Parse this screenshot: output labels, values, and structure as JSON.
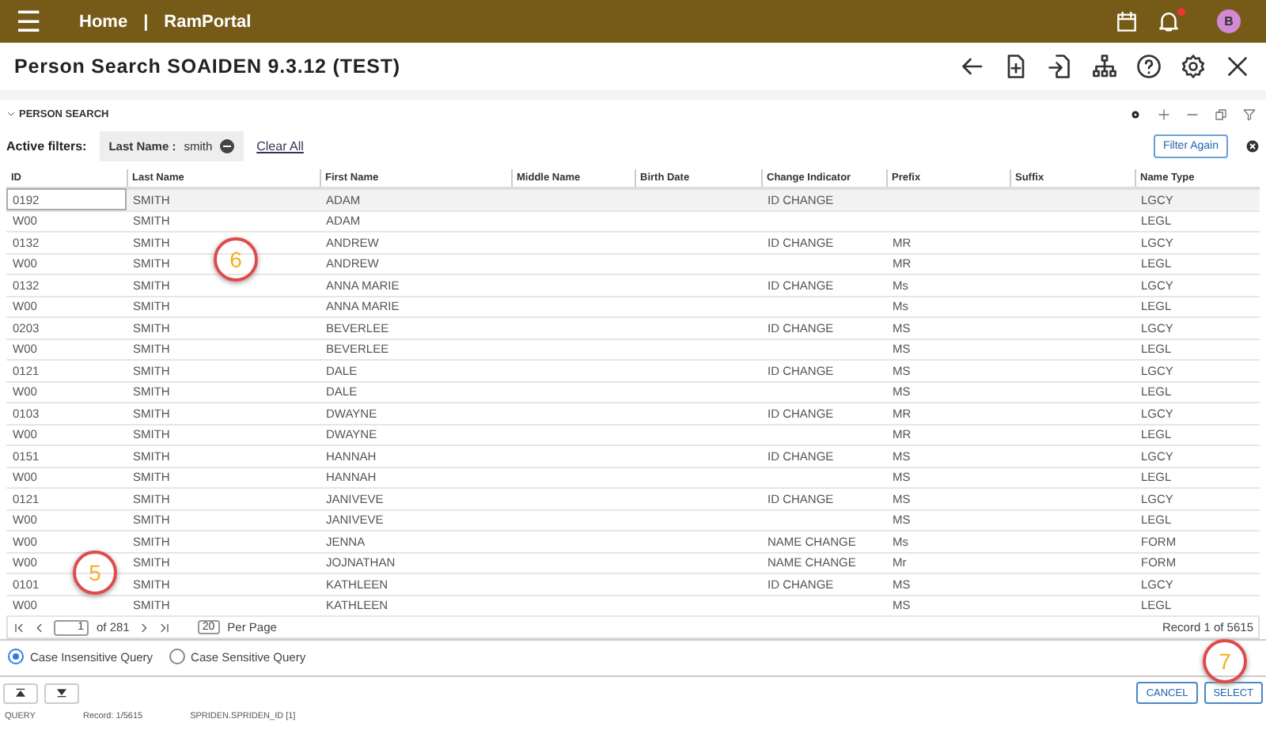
{
  "topbar": {
    "menu_icon": "☰",
    "home": "Home",
    "separator": "|",
    "portal": "RamPortal",
    "avatar": "B",
    "notification": true
  },
  "window": {
    "title": "Person Search SOAIDEN 9.3.12 (TEST)"
  },
  "section": {
    "title": "PERSON SEARCH",
    "expanded": true
  },
  "filters": {
    "label": "Active filters:",
    "chips": [
      {
        "field": "Last Name :",
        "value": "smith"
      }
    ],
    "clear": "Clear All",
    "filter_again": "Filter Again"
  },
  "table": {
    "columns": [
      "ID",
      "Last Name",
      "First Name",
      "Middle Name",
      "Birth Date",
      "Change Indicator",
      "Prefix",
      "Suffix",
      "Name Type"
    ],
    "rows": [
      {
        "cells": [
          "0192",
          "SMITH",
          "ADAM",
          "",
          "",
          "ID CHANGE",
          "",
          "",
          "LGCY"
        ],
        "selected": true
      },
      {
        "cells": [
          "W00",
          "SMITH",
          "ADAM",
          "",
          "",
          "",
          "",
          "",
          "LEGL"
        ],
        "selected": false
      },
      {
        "cells": [
          "0132",
          "SMITH",
          "ANDREW",
          "",
          "",
          "ID CHANGE",
          "MR",
          "",
          "LGCY"
        ],
        "selected": false
      },
      {
        "cells": [
          "W00",
          "SMITH",
          "ANDREW",
          "",
          "",
          "",
          "MR",
          "",
          "LEGL"
        ],
        "selected": false
      },
      {
        "cells": [
          "0132",
          "SMITH",
          "ANNA MARIE",
          "",
          "",
          "ID CHANGE",
          "Ms",
          "",
          "LGCY"
        ],
        "selected": false
      },
      {
        "cells": [
          "W00",
          "SMITH",
          "ANNA MARIE",
          "",
          "",
          "",
          "Ms",
          "",
          "LEGL"
        ],
        "selected": false
      },
      {
        "cells": [
          "0203",
          "SMITH",
          "BEVERLEE",
          "",
          "",
          "ID CHANGE",
          "MS",
          "",
          "LGCY"
        ],
        "selected": false
      },
      {
        "cells": [
          "W00",
          "SMITH",
          "BEVERLEE",
          "",
          "",
          "",
          "MS",
          "",
          "LEGL"
        ],
        "selected": false
      },
      {
        "cells": [
          "0121",
          "SMITH",
          "DALE",
          "",
          "",
          "ID CHANGE",
          "MS",
          "",
          "LGCY"
        ],
        "selected": false
      },
      {
        "cells": [
          "W00",
          "SMITH",
          "DALE",
          "",
          "",
          "",
          "MS",
          "",
          "LEGL"
        ],
        "selected": false
      },
      {
        "cells": [
          "0103",
          "SMITH",
          "DWAYNE",
          "",
          "",
          "ID CHANGE",
          "MR",
          "",
          "LGCY"
        ],
        "selected": false
      },
      {
        "cells": [
          "W00",
          "SMITH",
          "DWAYNE",
          "",
          "",
          "",
          "MR",
          "",
          "LEGL"
        ],
        "selected": false
      },
      {
        "cells": [
          "0151",
          "SMITH",
          "HANNAH",
          "",
          "",
          "ID CHANGE",
          "MS",
          "",
          "LGCY"
        ],
        "selected": false
      },
      {
        "cells": [
          "W00",
          "SMITH",
          "HANNAH",
          "",
          "",
          "",
          "MS",
          "",
          "LEGL"
        ],
        "selected": false
      },
      {
        "cells": [
          "0121",
          "SMITH",
          "JANIVEVE",
          "",
          "",
          "ID CHANGE",
          "MS",
          "",
          "LGCY"
        ],
        "selected": false
      },
      {
        "cells": [
          "W00",
          "SMITH",
          "JANIVEVE",
          "",
          "",
          "",
          "MS",
          "",
          "LEGL"
        ],
        "selected": false
      },
      {
        "cells": [
          "W00",
          "SMITH",
          "JENNA",
          "",
          "",
          "NAME CHANGE",
          "Ms",
          "",
          "FORM"
        ],
        "selected": false
      },
      {
        "cells": [
          "W00",
          "SMITH",
          "JOJNATHAN",
          "",
          "",
          "NAME CHANGE",
          "Mr",
          "",
          "FORM"
        ],
        "selected": false
      },
      {
        "cells": [
          "0101",
          "SMITH",
          "KATHLEEN",
          "",
          "",
          "ID CHANGE",
          "MS",
          "",
          "LGCY"
        ],
        "selected": false
      },
      {
        "cells": [
          "W00",
          "SMITH",
          "KATHLEEN",
          "",
          "",
          "",
          "MS",
          "",
          "LEGL"
        ],
        "selected": false
      }
    ]
  },
  "pager": {
    "page": "1",
    "of": "of 281",
    "per_page": "20",
    "per_page_label": "Per Page",
    "record": "Record 1 of 5615"
  },
  "query_options": [
    {
      "label": "Case Insensitive Query",
      "selected": true
    },
    {
      "label": "Case Sensitive Query",
      "selected": false
    }
  ],
  "buttons": [
    "CANCEL",
    "SELECT"
  ],
  "status_bar": {
    "mode": "QUERY",
    "record": "Record: 1/5615",
    "field": "SPRIDEN.SPRIDEN_ID [1]"
  },
  "callouts": [
    "6",
    "5",
    "7"
  ]
}
